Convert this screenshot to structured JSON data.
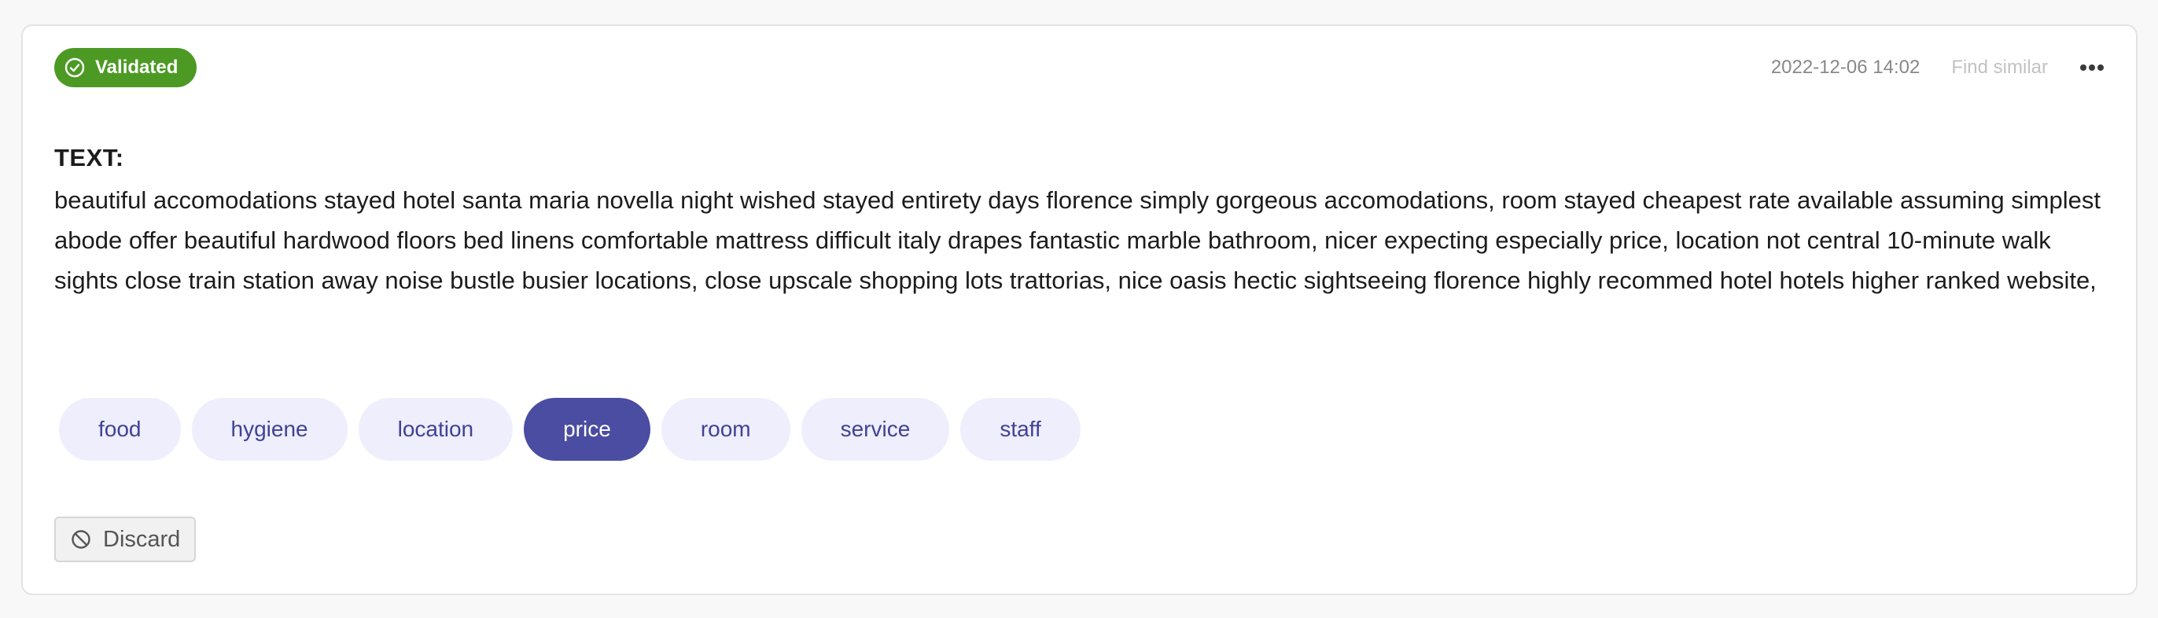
{
  "status": {
    "label": "Validated",
    "icon": "check-circle-icon",
    "color": "#4c9a24"
  },
  "meta": {
    "timestamp": "2022-12-06 14:02",
    "find_similar_label": "Find similar",
    "more_icon": "ellipsis-icon"
  },
  "record": {
    "field_label": "TEXT:",
    "text": "beautiful accomodations stayed hotel santa maria novella night wished stayed entirety days florence simply gorgeous accomodations, room stayed cheapest rate available assuming simplest abode offer beautiful hardwood floors bed linens comfortable mattress difficult italy drapes fantastic marble bathroom, nicer expecting especially price, location not central 10-minute walk sights close train station away noise bustle busier locations, close upscale shopping lots trattorias, nice oasis hectic sightseeing florence highly recommed hotel hotels higher ranked website,"
  },
  "labels": {
    "items": [
      {
        "label": "food",
        "selected": false
      },
      {
        "label": "hygiene",
        "selected": false
      },
      {
        "label": "location",
        "selected": false
      },
      {
        "label": "price",
        "selected": true
      },
      {
        "label": "room",
        "selected": false
      },
      {
        "label": "service",
        "selected": false
      },
      {
        "label": "staff",
        "selected": false
      }
    ],
    "selected_color": "#4a4da1",
    "unselected_color": "#eeeefc"
  },
  "actions": {
    "discard_label": "Discard",
    "discard_icon": "ban-icon"
  }
}
